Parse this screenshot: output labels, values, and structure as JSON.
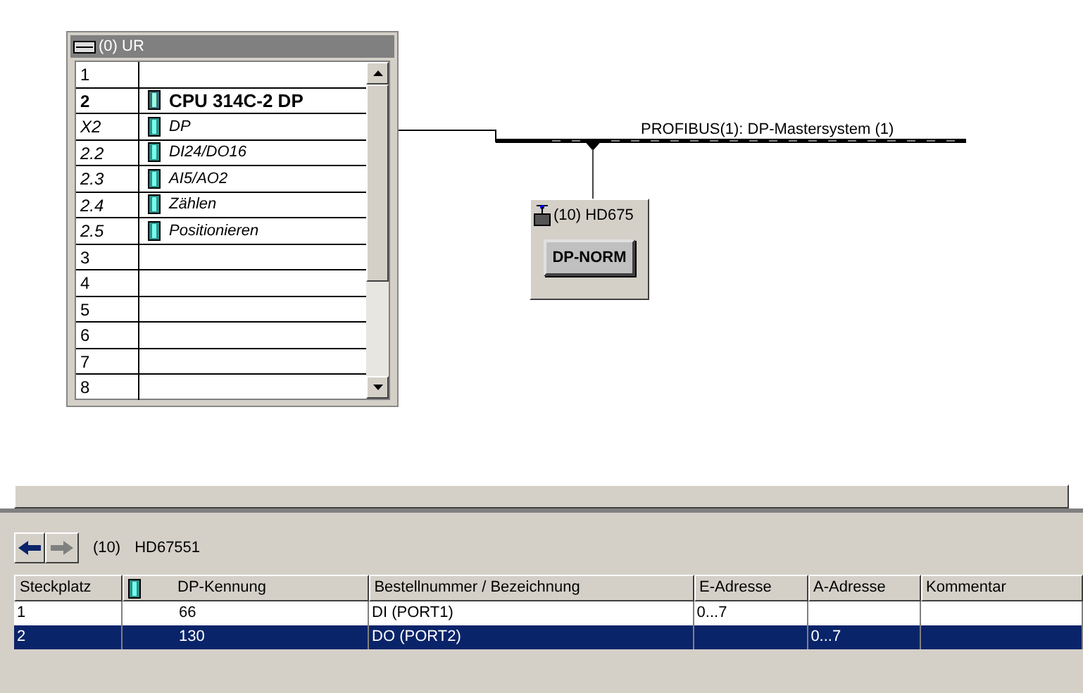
{
  "rack": {
    "title": "(0) UR",
    "rows": [
      {
        "slot": "1",
        "module": "",
        "kind": "empty"
      },
      {
        "slot": "2",
        "module": "CPU 314C-2 DP",
        "kind": "cpu"
      },
      {
        "slot": "X2",
        "module": "DP",
        "kind": "sub"
      },
      {
        "slot": "2.2",
        "module": "DI24/DO16",
        "kind": "sub"
      },
      {
        "slot": "2.3",
        "module": "AI5/AO2",
        "kind": "sub"
      },
      {
        "slot": "2.4",
        "module": "Zählen",
        "kind": "sub"
      },
      {
        "slot": "2.5",
        "module": "Positionieren",
        "kind": "sub"
      },
      {
        "slot": "3",
        "module": "",
        "kind": "empty"
      },
      {
        "slot": "4",
        "module": "",
        "kind": "empty"
      },
      {
        "slot": "5",
        "module": "",
        "kind": "empty"
      },
      {
        "slot": "6",
        "module": "",
        "kind": "empty"
      },
      {
        "slot": "7",
        "module": "",
        "kind": "empty"
      },
      {
        "slot": "8",
        "module": "",
        "kind": "empty"
      }
    ]
  },
  "bus": {
    "label": "PROFIBUS(1): DP-Mastersystem (1)"
  },
  "slave": {
    "title": "(10) HD675",
    "button": "DP-NORM"
  },
  "detail": {
    "number": "(10)",
    "name": "HD67551",
    "columns": [
      "Steckplatz",
      "DP-Kennung",
      "Bestellnummer / Bezeichnung",
      "E-Adresse",
      "A-Adresse",
      "Kommentar"
    ],
    "rows": [
      {
        "cells": [
          "1",
          "66",
          "DI  (PORT1)",
          "0...7",
          "",
          ""
        ],
        "selected": false
      },
      {
        "cells": [
          "2",
          "130",
          "DO  (PORT2)",
          "",
          "0...7",
          ""
        ],
        "selected": true
      }
    ]
  }
}
